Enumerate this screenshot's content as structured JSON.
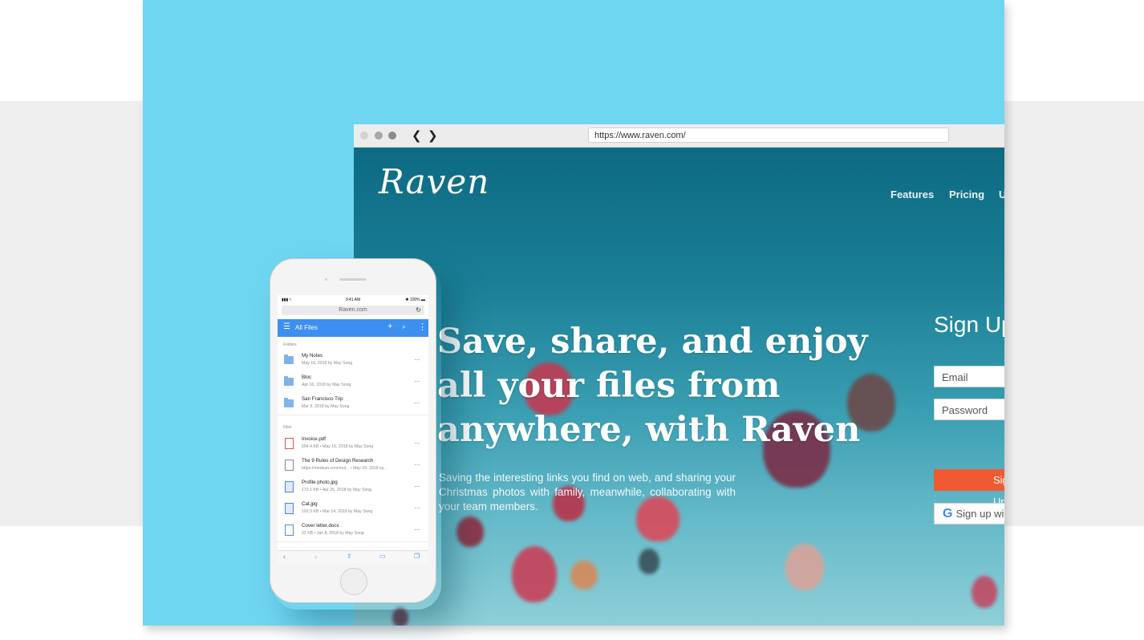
{
  "browser": {
    "url": "https://www.raven.com/",
    "back_glyph": "❮",
    "forward_glyph": "❯"
  },
  "site": {
    "logo": "Raven",
    "nav": [
      "Features",
      "Pricing",
      "U"
    ],
    "hero_title": "Save, share, and enjoy all your files from anywhere, with Raven",
    "hero_subtitle": "Saving the interesting links you find on web, and sharing your Christmas photos with family, meanwhile, collaborating with your team members.",
    "signup": {
      "title": "Sign Up",
      "email_placeholder": "Email",
      "password_placeholder": "Password",
      "submit_label": "Sign Up",
      "google_label": "Sign up with Google"
    }
  },
  "phone": {
    "status_time": "9:41 AM",
    "status_signal": "▮▮▮ ≈",
    "status_battery": "✱ 100% ▬",
    "url": "Raven.com",
    "header_title": "All Files",
    "folders_label": "Folders",
    "files_label": "Files",
    "folders": [
      {
        "name": "My Notes",
        "meta": "May 16, 2018 by May Song"
      },
      {
        "name": "Bloc",
        "meta": "Apr 16, 2018 by May Song"
      },
      {
        "name": "San Francisco Trip",
        "meta": "Mar 9, 2018 by May Song"
      }
    ],
    "files": [
      {
        "name": "Invoice.pdf",
        "meta": "654.4 KB • May 16, 2018 by May Song",
        "icon": "pdf-icon"
      },
      {
        "name": "The 9 Rules of Design Research",
        "meta": "https://medium.com/mul... • May 10, 2018 by...",
        "icon": "link-icon"
      },
      {
        "name": "Profile photo.jpg",
        "meta": "172.1 KB • Apr 25, 2018 by May Song",
        "icon": "image-icon"
      },
      {
        "name": "Cat.jpg",
        "meta": "102.5 KB • Mar 14, 2018 by May Song",
        "icon": "image-icon"
      },
      {
        "name": "Cover letter.docx",
        "meta": "22 KB • Jan 8, 2018 by May Song",
        "icon": "document-icon"
      }
    ],
    "more_glyph": "···"
  },
  "colors": {
    "accent_cyan": "#6fd6f2",
    "app_blue": "#3d8ff0",
    "signup_orange": "#f05a32"
  }
}
